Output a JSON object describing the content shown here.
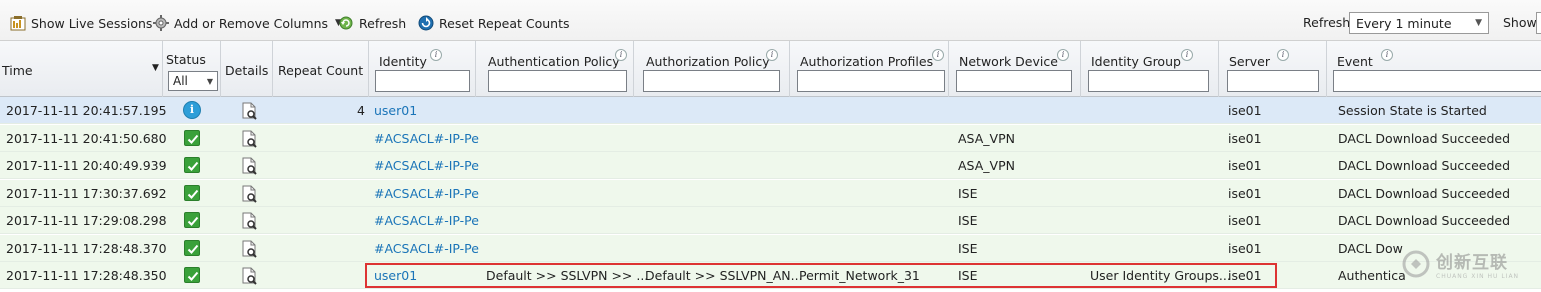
{
  "toolbar": {
    "show_live_sessions": "Show Live Sessions",
    "add_remove_columns": "Add or Remove Columns",
    "refresh": "Refresh",
    "reset_repeat_counts": "Reset Repeat Counts",
    "refresh_label": "Refresh",
    "refresh_interval": "Every 1 minute",
    "show_label": "Show"
  },
  "columns": {
    "time": "Time",
    "status": "Status",
    "status_filter": "All",
    "details": "Details",
    "repeat_count": "Repeat Count",
    "identity": "Identity",
    "authentication_policy": "Authentication Policy",
    "authorization_policy": "Authorization Policy",
    "authorization_profiles": "Authorization Profiles",
    "network_device": "Network Device",
    "identity_group": "Identity Group",
    "server": "Server",
    "event": "Event"
  },
  "rows": [
    {
      "time": "2017-11-11 20:41:57.195",
      "status": "info",
      "repeat": "4",
      "identity": "user01",
      "authn": "",
      "authz": "",
      "profiles": "",
      "device": "",
      "group": "",
      "server": "ise01",
      "event": "Session State is Started"
    },
    {
      "time": "2017-11-11 20:41:50.680",
      "status": "ok",
      "repeat": "",
      "identity": "#ACSACL#-IP-Pe",
      "authn": "",
      "authz": "",
      "profiles": "",
      "device": "ASA_VPN",
      "group": "",
      "server": "ise01",
      "event": "DACL Download Succeeded"
    },
    {
      "time": "2017-11-11 20:40:49.939",
      "status": "ok",
      "repeat": "",
      "identity": "#ACSACL#-IP-Pe",
      "authn": "",
      "authz": "",
      "profiles": "",
      "device": "ASA_VPN",
      "group": "",
      "server": "ise01",
      "event": "DACL Download Succeeded"
    },
    {
      "time": "2017-11-11 17:30:37.692",
      "status": "ok",
      "repeat": "",
      "identity": "#ACSACL#-IP-Pe",
      "authn": "",
      "authz": "",
      "profiles": "",
      "device": "ISE",
      "group": "",
      "server": "ise01",
      "event": "DACL Download Succeeded"
    },
    {
      "time": "2017-11-11 17:29:08.298",
      "status": "ok",
      "repeat": "",
      "identity": "#ACSACL#-IP-Pe",
      "authn": "",
      "authz": "",
      "profiles": "",
      "device": "ISE",
      "group": "",
      "server": "ise01",
      "event": "DACL Download Succeeded"
    },
    {
      "time": "2017-11-11 17:28:48.370",
      "status": "ok",
      "repeat": "",
      "identity": "#ACSACL#-IP-Pe",
      "authn": "",
      "authz": "",
      "profiles": "",
      "device": "ISE",
      "group": "",
      "server": "ise01",
      "event": "DACL Dow"
    },
    {
      "time": "2017-11-11 17:28:48.350",
      "status": "ok",
      "repeat": "",
      "identity": "user01",
      "authn": "Default >> SSLVPN >> ...",
      "authz": "Default >> SSLVPN_AN...",
      "profiles": "Permit_Network_31",
      "device": "ISE",
      "group": "User Identity Groups...",
      "server": "ise01",
      "event": "Authentica"
    }
  ],
  "watermark": {
    "main": "创新互联",
    "sub": "CHUANG XIN HU LIAN"
  },
  "colors": {
    "link": "#1a74b8",
    "ok": "#3aa13a",
    "info": "#2e9ed8",
    "highlight": "#d33"
  }
}
